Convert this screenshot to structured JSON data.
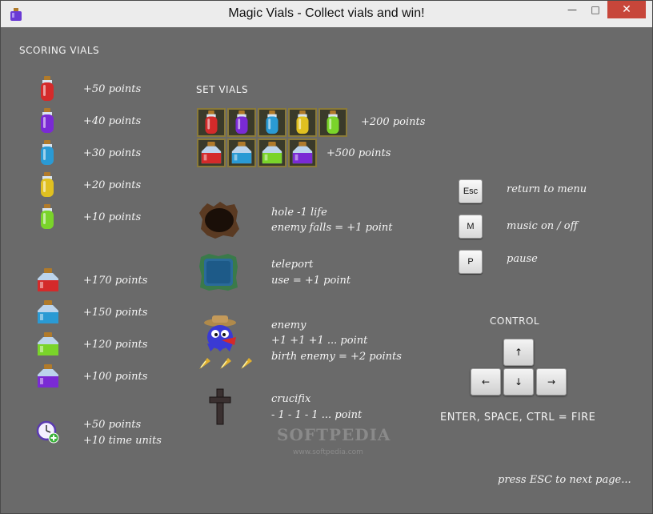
{
  "window": {
    "title": "Magic Vials - Collect vials and win!",
    "min_label": "—",
    "max_label": "□",
    "close_label": "✕"
  },
  "scoring": {
    "header": "SCORING VIALS",
    "small": [
      {
        "points": "+50 points",
        "color": "#d42a2a"
      },
      {
        "points": "+40 points",
        "color": "#7a2ad4"
      },
      {
        "points": "+30 points",
        "color": "#2a9ad4"
      },
      {
        "points": "+20 points",
        "color": "#e0c020"
      },
      {
        "points": "+10 points",
        "color": "#7ad42a"
      }
    ],
    "large": [
      {
        "points": "+170 points",
        "color": "#d42a2a"
      },
      {
        "points": "+150 points",
        "color": "#2a9ad4"
      },
      {
        "points": "+120 points",
        "color": "#7ad42a"
      },
      {
        "points": "+100 points",
        "color": "#7a2ad4"
      }
    ],
    "clock_line1": "+50 points",
    "clock_line2": "+10 time units"
  },
  "sets": {
    "header": "SET VIALS",
    "row1_points": "+200 points",
    "row1_colors": [
      "#d42a2a",
      "#7a2ad4",
      "#2a9ad4",
      "#e0c020",
      "#7ad42a"
    ],
    "row2_points": "+500 points",
    "row2_colors": [
      "#d42a2a",
      "#2a9ad4",
      "#7ad42a",
      "#7a2ad4"
    ]
  },
  "items": {
    "hole_line1": "hole   -1 life",
    "hole_line2": "enemy falls = +1 point",
    "teleport_line1": "teleport",
    "teleport_line2": "use = +1 point",
    "enemy_line1": "enemy",
    "enemy_line2": "+1 +1 +1 ... point",
    "enemy_line3": "birth enemy = +2 points",
    "crucifix_line1": "crucifix",
    "crucifix_line2": "- 1 - 1 - 1 ... point"
  },
  "keys": {
    "esc_key": "Esc",
    "esc_label": "return to menu",
    "m_key": "M",
    "m_label": "music on / off",
    "p_key": "P",
    "p_label": "pause"
  },
  "control": {
    "header": "CONTROL",
    "up": "↑",
    "left": "←",
    "down": "↓",
    "right": "→",
    "fire": "ENTER, SPACE, CTRL = FIRE"
  },
  "footer": "press ESC to next page...",
  "watermark": {
    "brand": "SOFTPEDIA",
    "url": "www.softpedia.com"
  }
}
